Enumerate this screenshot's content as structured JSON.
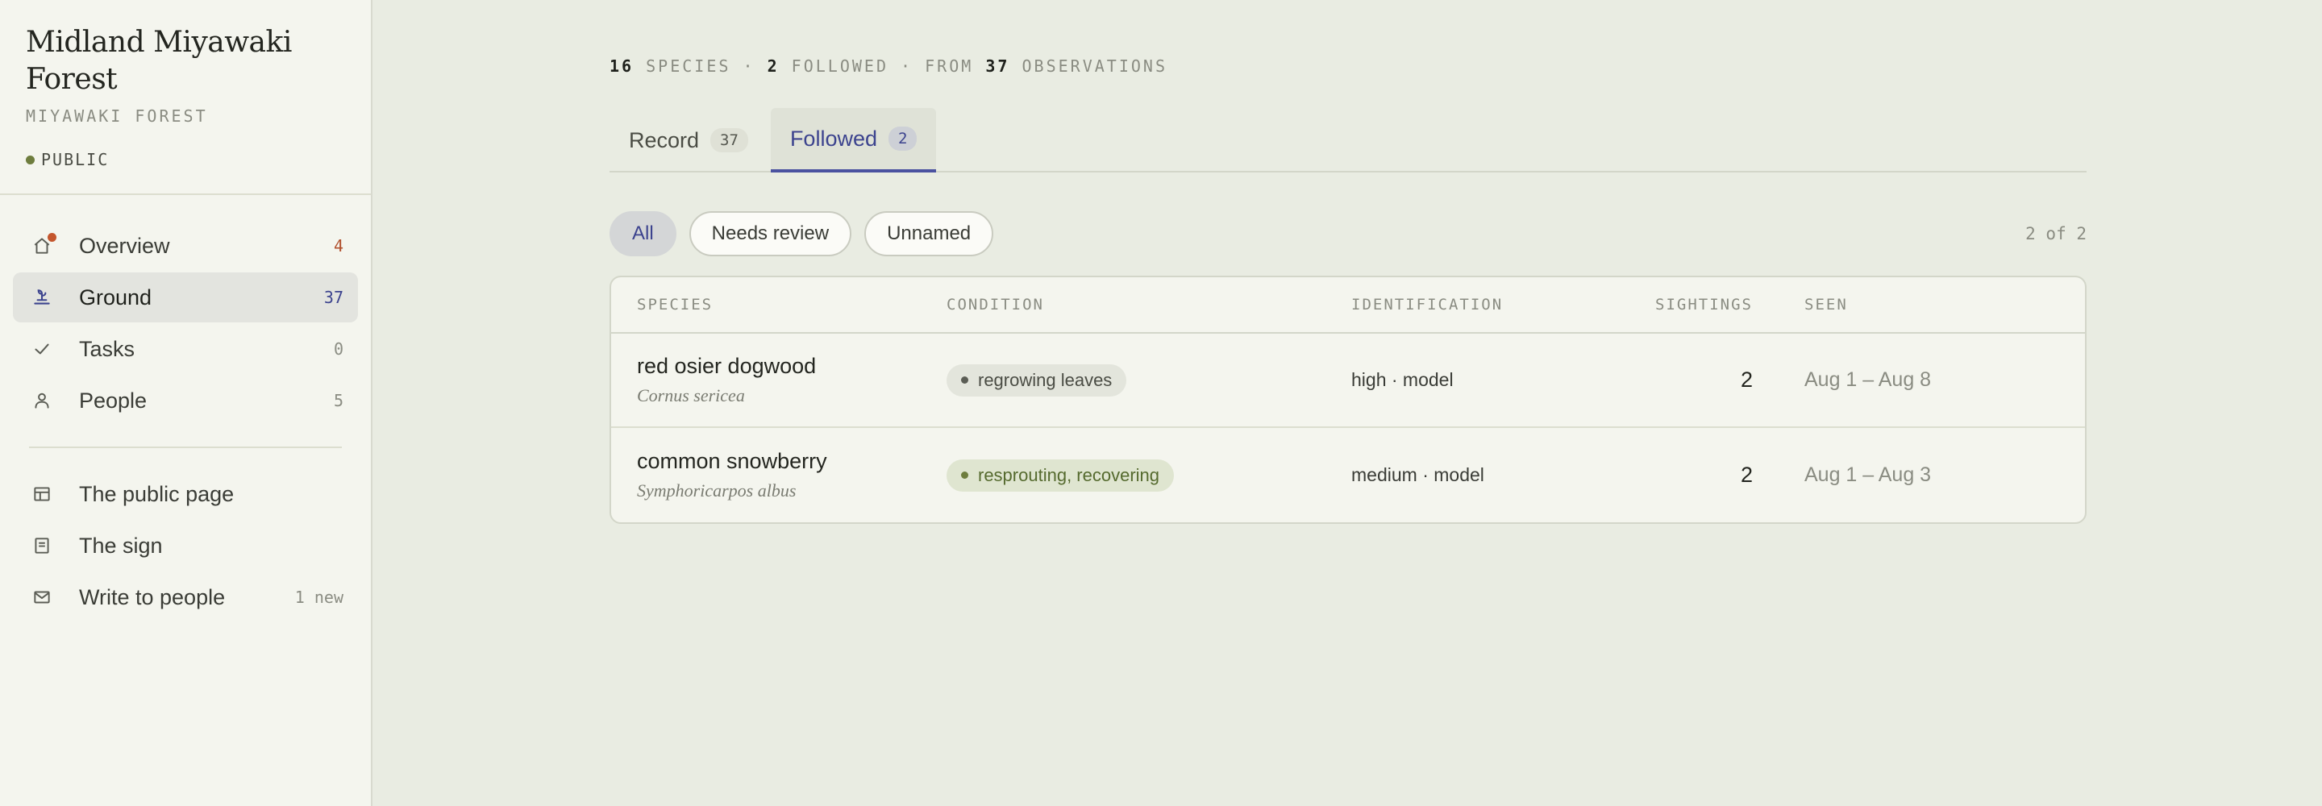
{
  "site": {
    "title": "Midland Miyawaki Forest",
    "subtitle": "MIYAWAKI FOREST",
    "visibility": "PUBLIC"
  },
  "nav": {
    "primary": [
      {
        "label": "Overview",
        "count": "4"
      },
      {
        "label": "Ground",
        "count": "37"
      },
      {
        "label": "Tasks",
        "count": "0"
      },
      {
        "label": "People",
        "count": "5"
      }
    ],
    "secondary": [
      {
        "label": "The public page",
        "count": ""
      },
      {
        "label": "The sign",
        "count": ""
      },
      {
        "label": "Write to people",
        "count": "1 new"
      }
    ]
  },
  "stats": {
    "species_count": "16",
    "species_label": "SPECIES",
    "followed_count": "2",
    "followed_label": "FOLLOWED",
    "from_label": "FROM",
    "observations_count": "37",
    "observations_label": "OBSERVATIONS"
  },
  "tabs": [
    {
      "label": "Record",
      "count": "37"
    },
    {
      "label": "Followed",
      "count": "2"
    }
  ],
  "filters": [
    "All",
    "Needs review",
    "Unnamed"
  ],
  "result_count": "2 of 2",
  "table": {
    "headers": [
      "SPECIES",
      "CONDITION",
      "IDENTIFICATION",
      "SIGHTINGS",
      "SEEN"
    ],
    "rows": [
      {
        "name": "red osier dogwood",
        "scientific": "Cornus sericea",
        "condition": "regrowing leaves",
        "identification": "high · model",
        "sightings": "2",
        "seen": "Aug 1 – Aug 8"
      },
      {
        "name": "common snowberry",
        "scientific": "Symphoricarpos albus",
        "condition": "resprouting, recovering",
        "identification": "medium · model",
        "sightings": "2",
        "seen": "Aug 1 – Aug 3"
      }
    ]
  },
  "colors": {
    "accent": "#3c438e",
    "alert": "#c4562d",
    "public_dot": "#6e7d3e"
  }
}
